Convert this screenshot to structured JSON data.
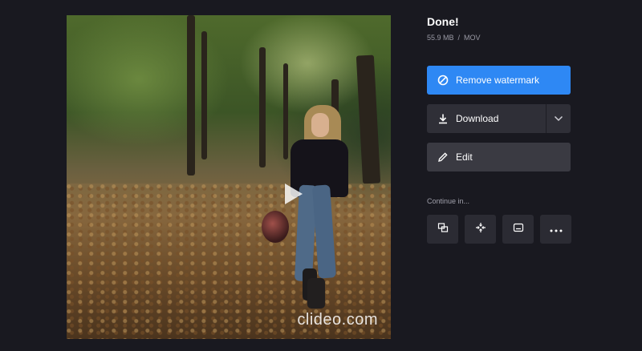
{
  "video": {
    "watermark": "clideo.com"
  },
  "result": {
    "status_title": "Done!",
    "file_size": "55.9 MB",
    "separator": "/",
    "file_format": "MOV"
  },
  "buttons": {
    "remove_watermark": "Remove watermark",
    "download": "Download",
    "edit": "Edit"
  },
  "continue": {
    "label": "Continue in...",
    "tools": [
      "merge-icon",
      "compress-icon",
      "subtitles-icon",
      "more-icon"
    ]
  },
  "colors": {
    "background": "#191920",
    "primary": "#2e88f4",
    "secondary_button": "#2f2f37"
  }
}
